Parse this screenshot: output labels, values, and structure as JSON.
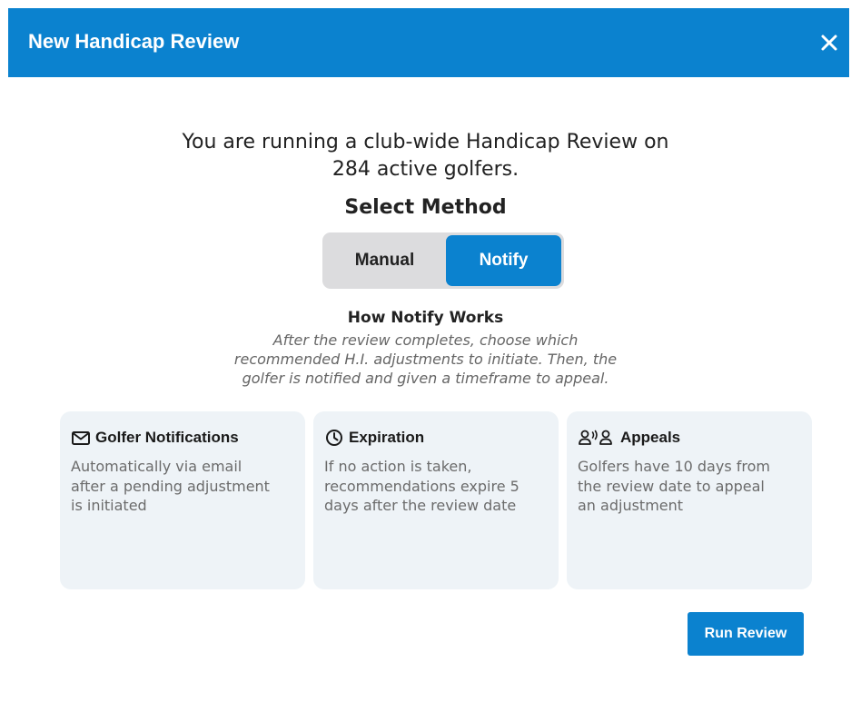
{
  "header": {
    "title": "New Handicap Review",
    "close_icon": "close-icon"
  },
  "intro": {
    "line1": "You are running a club-wide Handicap Review on",
    "line2": "284 active golfers."
  },
  "method": {
    "label": "Select Method",
    "options": [
      "Manual",
      "Notify"
    ],
    "selected": "Notify"
  },
  "how": {
    "title": "How Notify Works",
    "lines": [
      "After the review completes, choose which",
      "recommended H.I. adjustments to initiate. Then, the",
      "golfer is notified and given a timeframe to appeal."
    ]
  },
  "cards": [
    {
      "icon": "envelope-icon",
      "title": "Golfer Notifications",
      "lines": [
        "Automatically via email",
        "after a pending adjustment",
        "is initiated"
      ]
    },
    {
      "icon": "clock-icon",
      "title": "Expiration",
      "lines": [
        "If no action is taken,",
        "recommendations expire 5",
        "days after the review date"
      ]
    },
    {
      "icon": "people-icon",
      "title": "Appeals",
      "lines": [
        "Golfers have 10 days from",
        "the review date to appeal",
        "an adjustment"
      ]
    }
  ],
  "actions": {
    "run_label": "Run Review"
  },
  "colors": {
    "accent": "#0b82cf",
    "card_bg": "#eef3f7",
    "toggle_bg": "#dcdcde"
  }
}
